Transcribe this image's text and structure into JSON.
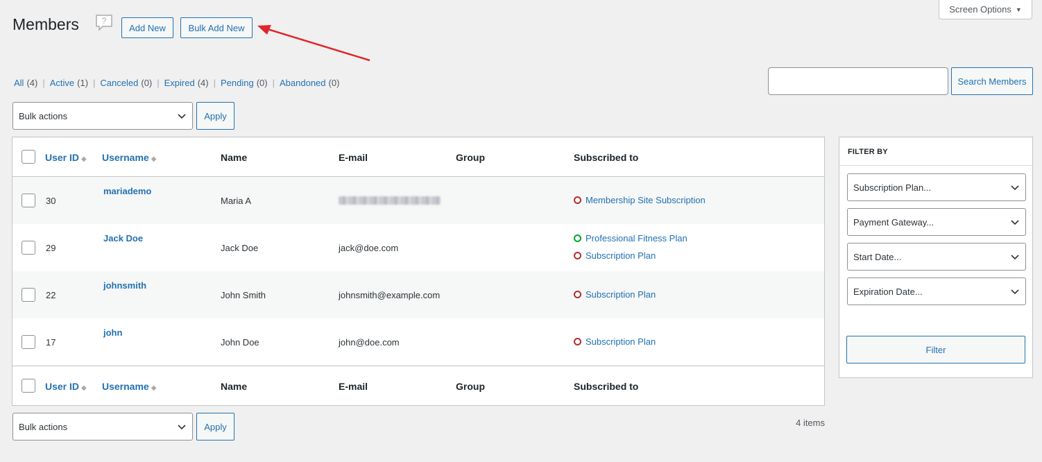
{
  "header": {
    "title": "Members",
    "add_new": "Add New",
    "bulk_add_new": "Bulk Add New",
    "screen_options": "Screen Options"
  },
  "status_filters": [
    {
      "label": "All",
      "count": "(4)"
    },
    {
      "label": "Active",
      "count": "(1)"
    },
    {
      "label": "Canceled",
      "count": "(0)"
    },
    {
      "label": "Expired",
      "count": "(4)"
    },
    {
      "label": "Pending",
      "count": "(0)"
    },
    {
      "label": "Abandoned",
      "count": "(0)"
    }
  ],
  "search": {
    "value": "",
    "button": "Search Members"
  },
  "bulk": {
    "label": "Bulk actions",
    "apply": "Apply"
  },
  "table": {
    "columns": [
      "User ID",
      "Username",
      "Name",
      "E-mail",
      "Group",
      "Subscribed to"
    ],
    "rows": [
      {
        "id": "30",
        "username": "mariademo",
        "name": "Maria A",
        "email": "",
        "subscriptions": [
          {
            "label": "Membership Site Subscription",
            "status": "inactive"
          }
        ]
      },
      {
        "id": "29",
        "username": "Jack Doe",
        "name": "Jack Doe",
        "email": "jack@doe.com",
        "subscriptions": [
          {
            "label": "Professional Fitness Plan",
            "status": "active"
          },
          {
            "label": "Subscription Plan",
            "status": "inactive"
          }
        ]
      },
      {
        "id": "22",
        "username": "johnsmith",
        "name": "John Smith",
        "email": "johnsmith@example.com",
        "subscriptions": [
          {
            "label": "Subscription Plan",
            "status": "inactive"
          }
        ]
      },
      {
        "id": "17",
        "username": "john",
        "name": "John Doe",
        "email": "john@doe.com",
        "subscriptions": [
          {
            "label": "Subscription Plan",
            "status": "inactive"
          }
        ]
      }
    ],
    "items_count": "4 items"
  },
  "filter_box": {
    "title": "FILTER BY",
    "selects": [
      "Subscription Plan...",
      "Payment Gateway...",
      "Start Date...",
      "Expiration Date..."
    ],
    "button": "Filter"
  },
  "colors": {
    "accent": "#2271b1",
    "status_active": "#00a32a",
    "status_inactive": "#b32d2e",
    "annotation_arrow": "#e0262b"
  }
}
